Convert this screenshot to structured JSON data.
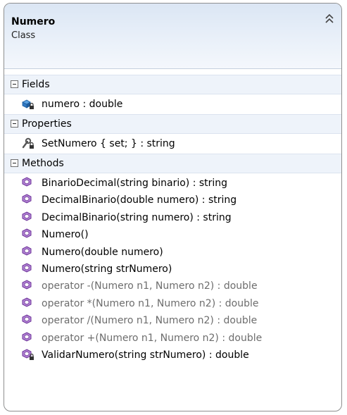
{
  "class": {
    "name": "Numero",
    "kind": "Class"
  },
  "sections": {
    "fields": "Fields",
    "properties": "Properties",
    "methods": "Methods"
  },
  "fields": [
    "numero : double"
  ],
  "properties": [
    "SetNumero { set; } : string"
  ],
  "methods": [
    "BinarioDecimal(string binario) : string",
    "DecimalBinario(double numero) : string",
    "DecimalBinario(string numero) : string",
    "Numero()",
    "Numero(double numero)",
    "Numero(string strNumero)",
    "operator -(Numero n1, Numero n2) : double",
    "operator *(Numero n1, Numero n2) : double",
    "operator /(Numero n1, Numero n2) : double",
    "operator +(Numero n1, Numero n2) : double",
    "ValidarNumero(string strNumero) : double"
  ],
  "icons": {
    "field": "private-field-icon",
    "property": "private-property-icon",
    "method": "method-icon",
    "private_method": "private-method-icon"
  },
  "colors": {
    "header": "#dbe6f4",
    "method_icon": "#7b3fa6",
    "operator_text": "#6d6d6d"
  }
}
